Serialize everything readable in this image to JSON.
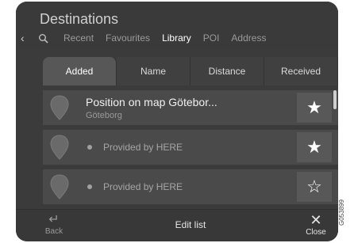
{
  "header": {
    "title": "Destinations",
    "back_icon": "chevron-left-icon",
    "search_icon": "search-icon",
    "tabs": [
      "Recent",
      "Favourites",
      "Library",
      "POI",
      "Address"
    ],
    "active_tab": "Library"
  },
  "sort_tabs": {
    "items": [
      "Added",
      "Name",
      "Distance",
      "Received"
    ],
    "active": "Added"
  },
  "list": {
    "items": [
      {
        "title": "Position on map Götebor...",
        "subtitle": "Göteborg",
        "favourite": true
      },
      {
        "provider": "Provided by HERE",
        "favourite": true
      },
      {
        "provider": "Provided by HERE",
        "favourite": false
      }
    ],
    "star_filled": "★",
    "star_empty": "☆"
  },
  "bottom_bar": {
    "back_label": "Back",
    "edit_label": "Edit list",
    "close_label": "Close",
    "close_glyph": "✕"
  },
  "figure_code": "G053899",
  "colors": {
    "screen_bg": "#3b3b3b",
    "row_bg": "#4a4a4a",
    "active_text": "#ffffff",
    "inactive_text": "#9a9a9a"
  }
}
